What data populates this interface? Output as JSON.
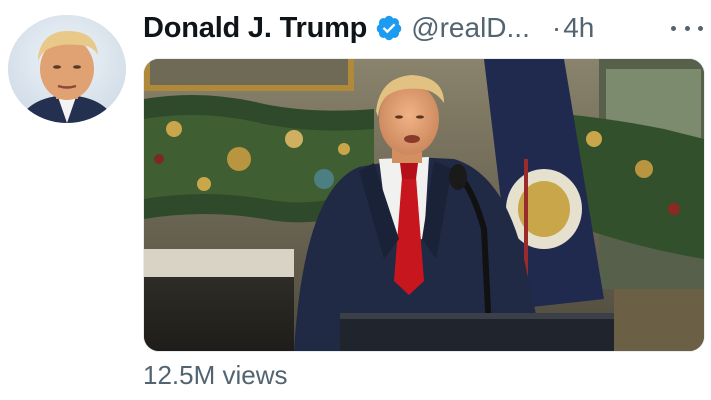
{
  "tweet": {
    "display_name": "Donald J. Trump",
    "handle": "@realD...",
    "separator": "·",
    "timestamp": "4h",
    "views": "12.5M views"
  },
  "icons": {
    "verified": "verified-badge-icon",
    "more": "more-dots-icon"
  },
  "colors": {
    "verified_blue": "#1d9bf0",
    "secondary_text": "#536471",
    "primary_text": "#0f1419"
  }
}
